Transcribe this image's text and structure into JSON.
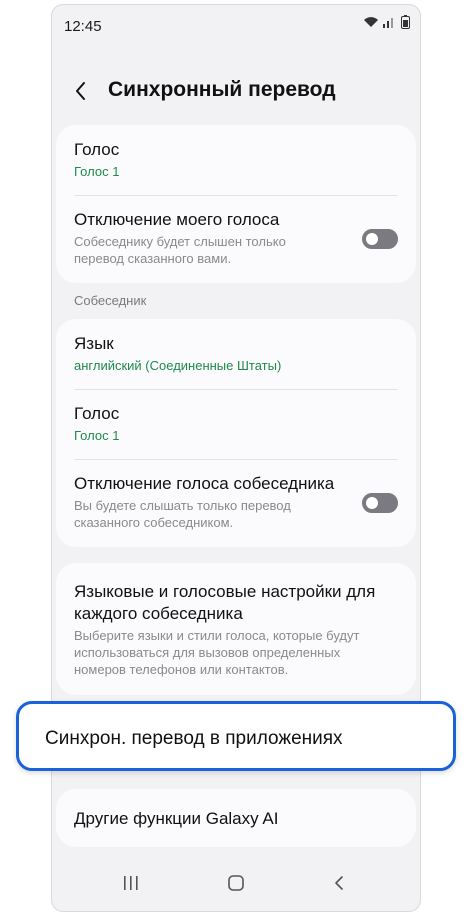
{
  "status_bar": {
    "time": "12:45"
  },
  "header": {
    "title": "Синхронный перевод"
  },
  "my_section": {
    "voice": {
      "title": "Голос",
      "value": "Голос 1"
    },
    "mute_my_voice": {
      "title": "Отключение моего голоса",
      "description_line1": "Собеседнику будет слышен только",
      "description_line2": "перевод сказанного вами.",
      "enabled": false
    }
  },
  "partner_section": {
    "header": "Собеседник",
    "language": {
      "title": "Язык",
      "value": "английский (Соединенные Штаты)"
    },
    "voice": {
      "title": "Голос",
      "value": "Голос 1"
    },
    "mute_partner_voice": {
      "title": "Отключение голоса собеседника",
      "description_line1": "Вы будете слышать только перевод",
      "description_line2": "сказанного собеседником.",
      "enabled": false
    }
  },
  "per_contact": {
    "title_line1": "Языковые и голосовые настройки для",
    "title_line2": "каждого собеседника",
    "description_line1": "Выберите языки и стили голоса, которые будут",
    "description_line2": "использоваться для вызовов определенных",
    "description_line3": "номеров телефонов или контактов."
  },
  "in_apps": {
    "label": "Синхрон. перевод в приложениях"
  },
  "other": {
    "label": "Другие функции Galaxy AI"
  },
  "colors": {
    "accent": "#1a62d9",
    "green_value": "#1e8a4a"
  },
  "nav": {
    "icons": [
      "recent-apps-icon",
      "home-icon",
      "back-icon"
    ]
  }
}
